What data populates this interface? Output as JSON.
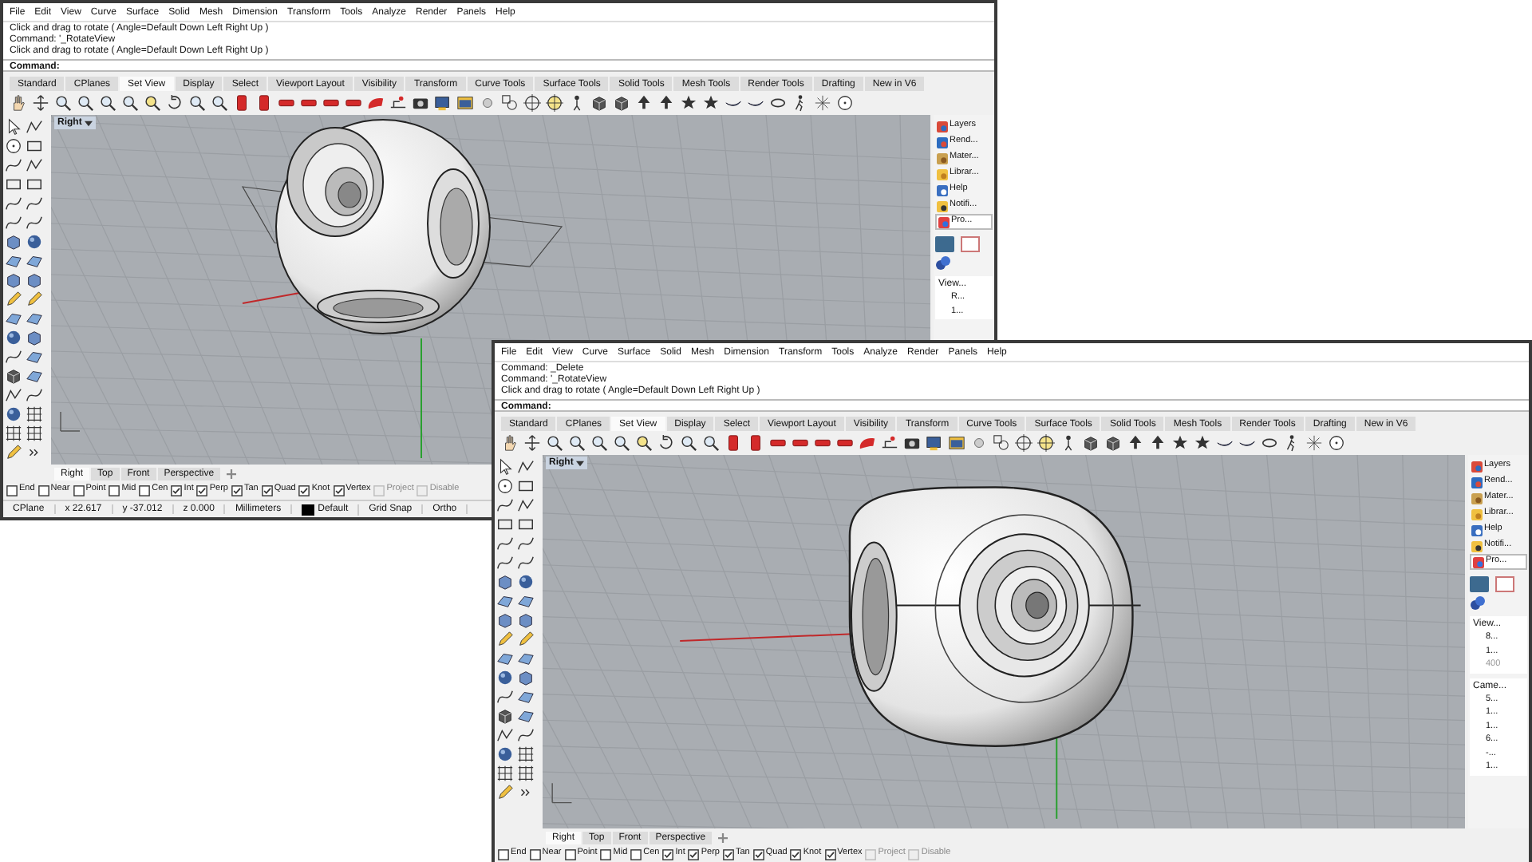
{
  "windows": [
    {
      "menu": [
        "File",
        "Edit",
        "View",
        "Curve",
        "Surface",
        "Solid",
        "Mesh",
        "Dimension",
        "Transform",
        "Tools",
        "Analyze",
        "Render",
        "Panels",
        "Help"
      ],
      "history": [
        "Click and drag to rotate ( Angle=Default  Down  Left  Right  Up )",
        "Command: '_RotateView",
        "Click and drag to rotate ( Angle=Default  Down  Left  Right  Up )"
      ],
      "prompt": "Command:",
      "toolbar_tabs": [
        {
          "label": "Standard",
          "selected": false
        },
        {
          "label": "CPlanes",
          "selected": false
        },
        {
          "label": "Set View",
          "selected": true
        },
        {
          "label": "Display",
          "selected": false
        },
        {
          "label": "Select",
          "selected": false
        },
        {
          "label": "Viewport Layout",
          "selected": false
        },
        {
          "label": "Visibility",
          "selected": false
        },
        {
          "label": "Transform",
          "selected": false
        },
        {
          "label": "Curve Tools",
          "selected": false
        },
        {
          "label": "Surface Tools",
          "selected": false
        },
        {
          "label": "Solid Tools",
          "selected": false
        },
        {
          "label": "Mesh Tools",
          "selected": false
        },
        {
          "label": "Render Tools",
          "selected": false
        },
        {
          "label": "Drafting",
          "selected": false
        },
        {
          "label": "New in V6",
          "selected": false
        }
      ],
      "viewport": {
        "title": "Right"
      },
      "panel": {
        "tabs": [
          {
            "label": "Layers",
            "selected": false
          },
          {
            "label": "Rend...",
            "selected": false
          },
          {
            "label": "Mater...",
            "selected": false
          },
          {
            "label": "Librar...",
            "selected": false
          },
          {
            "label": "Help",
            "selected": false
          },
          {
            "label": "Notifi...",
            "selected": false
          },
          {
            "label": "Pro...",
            "selected": true
          }
        ],
        "sections": [
          {
            "title": "View...",
            "fields": [
              {
                "value": "R...",
                "disabled": false
              },
              {
                "value": "1...",
                "disabled": false
              }
            ]
          }
        ]
      },
      "viewport_tabs": [
        {
          "label": "Right",
          "selected": true
        },
        {
          "label": "Top",
          "selected": false
        },
        {
          "label": "Front",
          "selected": false
        },
        {
          "label": "Perspective",
          "selected": false
        }
      ],
      "osnaps": [
        {
          "label": "End",
          "checked": false,
          "disabled": false
        },
        {
          "label": "Near",
          "checked": false,
          "disabled": false
        },
        {
          "label": "Point",
          "checked": false,
          "disabled": false
        },
        {
          "label": "Mid",
          "checked": false,
          "disabled": false
        },
        {
          "label": "Cen",
          "checked": false,
          "disabled": false
        },
        {
          "label": "Int",
          "checked": true,
          "disabled": false
        },
        {
          "label": "Perp",
          "checked": true,
          "disabled": false
        },
        {
          "label": "Tan",
          "checked": true,
          "disabled": false
        },
        {
          "label": "Quad",
          "checked": true,
          "disabled": false
        },
        {
          "label": "Knot",
          "checked": true,
          "disabled": false
        },
        {
          "label": "Vertex",
          "checked": true,
          "disabled": false
        },
        {
          "label": "Project",
          "checked": false,
          "disabled": true
        },
        {
          "label": "Disable",
          "checked": false,
          "disabled": true
        }
      ],
      "status": [
        {
          "text": "CPlane",
          "kind": "text"
        },
        {
          "text": "x 22.617",
          "kind": "text"
        },
        {
          "text": "y -37.012",
          "kind": "text"
        },
        {
          "text": "z 0.000",
          "kind": "text"
        },
        {
          "text": "Millimeters",
          "kind": "text"
        },
        {
          "text": "Default",
          "kind": "layer"
        },
        {
          "text": "Grid Snap",
          "kind": "text"
        },
        {
          "text": "Ortho",
          "kind": "text"
        }
      ]
    },
    {
      "menu": [
        "File",
        "Edit",
        "View",
        "Curve",
        "Surface",
        "Solid",
        "Mesh",
        "Dimension",
        "Transform",
        "Tools",
        "Analyze",
        "Render",
        "Panels",
        "Help"
      ],
      "history": [
        "Command: _Delete",
        "Command: '_RotateView",
        "Click and drag to rotate ( Angle=Default  Down  Left  Right  Up )"
      ],
      "prompt": "Command:",
      "toolbar_tabs": [
        {
          "label": "Standard",
          "selected": false
        },
        {
          "label": "CPlanes",
          "selected": false
        },
        {
          "label": "Set View",
          "selected": true
        },
        {
          "label": "Display",
          "selected": false
        },
        {
          "label": "Select",
          "selected": false
        },
        {
          "label": "Viewport Layout",
          "selected": false
        },
        {
          "label": "Visibility",
          "selected": false
        },
        {
          "label": "Transform",
          "selected": false
        },
        {
          "label": "Curve Tools",
          "selected": false
        },
        {
          "label": "Surface Tools",
          "selected": false
        },
        {
          "label": "Solid Tools",
          "selected": false
        },
        {
          "label": "Mesh Tools",
          "selected": false
        },
        {
          "label": "Render Tools",
          "selected": false
        },
        {
          "label": "Drafting",
          "selected": false
        },
        {
          "label": "New in V6",
          "selected": false
        }
      ],
      "viewport": {
        "title": "Right"
      },
      "panel": {
        "tabs": [
          {
            "label": "Layers",
            "selected": false
          },
          {
            "label": "Rend...",
            "selected": false
          },
          {
            "label": "Mater...",
            "selected": false
          },
          {
            "label": "Librar...",
            "selected": false
          },
          {
            "label": "Help",
            "selected": false
          },
          {
            "label": "Notifi...",
            "selected": false
          },
          {
            "label": "Pro...",
            "selected": true
          }
        ],
        "sections": [
          {
            "title": "View...",
            "fields": [
              {
                "value": "8...",
                "disabled": false
              },
              {
                "value": "1...",
                "disabled": false
              },
              {
                "value": "400",
                "disabled": true
              }
            ]
          },
          {
            "title": "Came...",
            "fields": [
              {
                "value": "5...",
                "disabled": false
              },
              {
                "value": "1...",
                "disabled": false
              },
              {
                "value": "1...",
                "disabled": false
              },
              {
                "value": "6...",
                "disabled": false
              },
              {
                "value": "-...",
                "disabled": false
              },
              {
                "value": "1...",
                "disabled": false
              }
            ]
          }
        ]
      },
      "viewport_tabs": [
        {
          "label": "Right",
          "selected": true
        },
        {
          "label": "Top",
          "selected": false
        },
        {
          "label": "Front",
          "selected": false
        },
        {
          "label": "Perspective",
          "selected": false
        }
      ],
      "osnaps": [
        {
          "label": "End",
          "checked": false,
          "disabled": false
        },
        {
          "label": "Near",
          "checked": false,
          "disabled": false
        },
        {
          "label": "Point",
          "checked": false,
          "disabled": false
        },
        {
          "label": "Mid",
          "checked": false,
          "disabled": false
        },
        {
          "label": "Cen",
          "checked": false,
          "disabled": false
        },
        {
          "label": "Int",
          "checked": true,
          "disabled": false
        },
        {
          "label": "Perp",
          "checked": true,
          "disabled": false
        },
        {
          "label": "Tan",
          "checked": true,
          "disabled": false
        },
        {
          "label": "Quad",
          "checked": true,
          "disabled": false
        },
        {
          "label": "Knot",
          "checked": true,
          "disabled": false
        },
        {
          "label": "Vertex",
          "checked": true,
          "disabled": false
        },
        {
          "label": "Project",
          "checked": false,
          "disabled": true
        },
        {
          "label": "Disable",
          "checked": false,
          "disabled": true
        }
      ]
    }
  ]
}
